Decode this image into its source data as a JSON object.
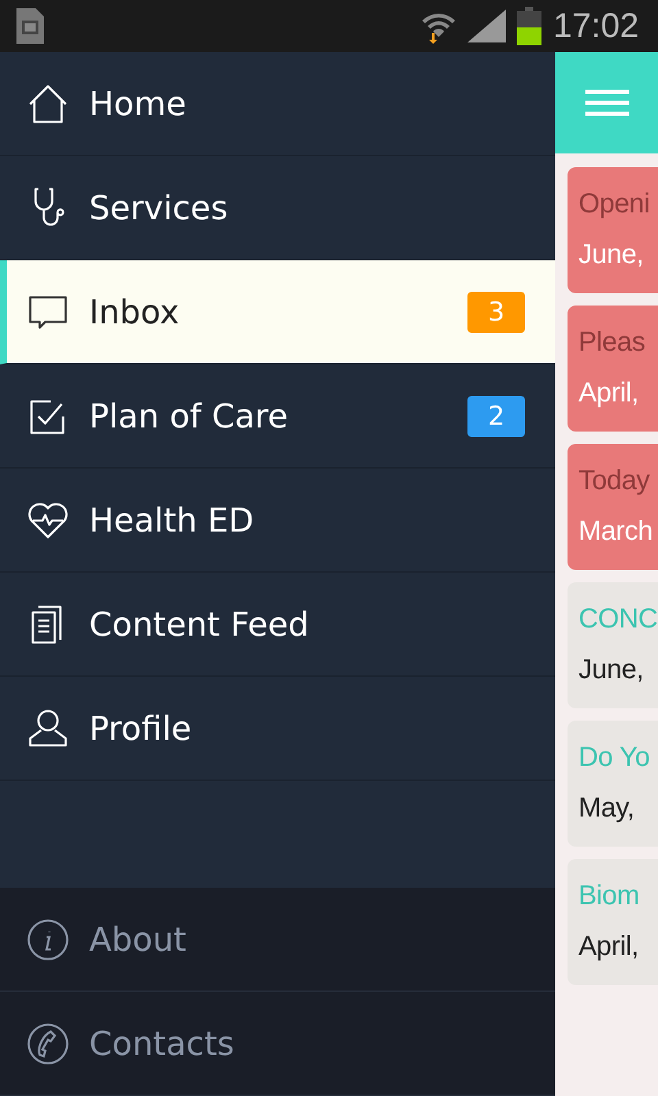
{
  "status_bar": {
    "time": "17:02"
  },
  "menu": [
    {
      "label": "Home",
      "kind": "home",
      "selected": false
    },
    {
      "label": "Services",
      "kind": "stethoscope",
      "selected": false
    },
    {
      "label": "Inbox",
      "kind": "chat",
      "selected": true,
      "badge": {
        "text": "3",
        "color": "#ff9800"
      }
    },
    {
      "label": "Plan of Care",
      "kind": "check",
      "selected": false,
      "badge": {
        "text": "2",
        "color": "#2d9bf0"
      }
    },
    {
      "label": "Health ED",
      "kind": "heart",
      "selected": false
    },
    {
      "label": "Content Feed",
      "kind": "document",
      "selected": false
    },
    {
      "label": "Profile",
      "kind": "person",
      "selected": false
    }
  ],
  "footer_menu": [
    {
      "label": "About",
      "kind": "info"
    },
    {
      "label": "Contacts",
      "kind": "phone"
    }
  ],
  "cards": [
    {
      "title": "Openi",
      "date": "June,",
      "kind": "alert"
    },
    {
      "title": "Pleas",
      "date": "April,",
      "kind": "alert"
    },
    {
      "title": "Today",
      "date": "March",
      "kind": "alert"
    },
    {
      "title": "CONC",
      "date": "June,",
      "kind": "normal"
    },
    {
      "title": "Do Yo",
      "date": "May,",
      "kind": "normal"
    },
    {
      "title": "Biom",
      "date": "April,",
      "kind": "normal"
    }
  ]
}
